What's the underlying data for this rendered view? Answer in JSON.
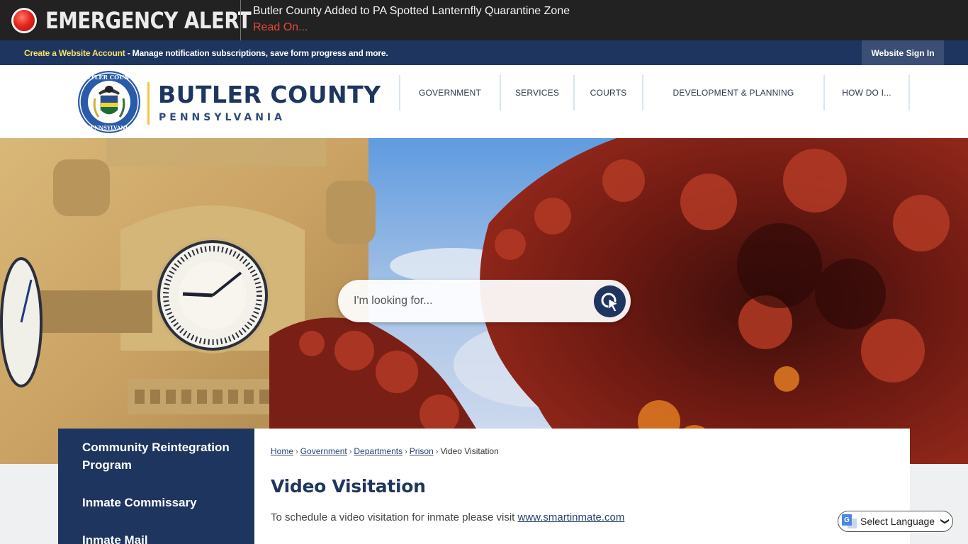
{
  "alert": {
    "label": "EMERGENCY ALERT",
    "headline": "Butler County Added to PA Spotted Lanternfly Quarantine Zone",
    "read_more": "Read On..."
  },
  "account_bar": {
    "link_text": "Create a Website Account",
    "description": " - Manage notification subscriptions, save form progress and more.",
    "sign_in": "Website Sign In"
  },
  "header": {
    "logo_name": "BUTLER COUNTY",
    "logo_state": "PENNSYLVANIA",
    "seal_alt": "Butler County Pennsylvania seal"
  },
  "nav": {
    "items": [
      {
        "label": "GOVERNMENT"
      },
      {
        "label": "SERVICES"
      },
      {
        "label": "COURTS"
      },
      {
        "label": "DEVELOPMENT & PLANNING"
      },
      {
        "label": "HOW DO I..."
      }
    ]
  },
  "search": {
    "placeholder": "I'm looking for..."
  },
  "sidebar": {
    "items": [
      {
        "label": "Community Reintegration Program"
      },
      {
        "label": "Inmate Commissary"
      },
      {
        "label": "Inmate Mail"
      }
    ]
  },
  "breadcrumb": {
    "items": [
      {
        "label": "Home"
      },
      {
        "label": "Government"
      },
      {
        "label": "Departments"
      },
      {
        "label": "Prison"
      }
    ],
    "current": "Video Visitation",
    "separator": "›"
  },
  "page": {
    "title": "Video Visitation",
    "body_text": "To schedule a video visitation for inmate please visit ",
    "link_text": "www.smartinmate.com"
  },
  "language": {
    "label": "Select Language"
  },
  "colors": {
    "primary_navy": "#1e365f",
    "alert_red": "#e6483c",
    "account_link_yellow": "#f4e067",
    "logo_accent_gold": "#f3c63c"
  }
}
